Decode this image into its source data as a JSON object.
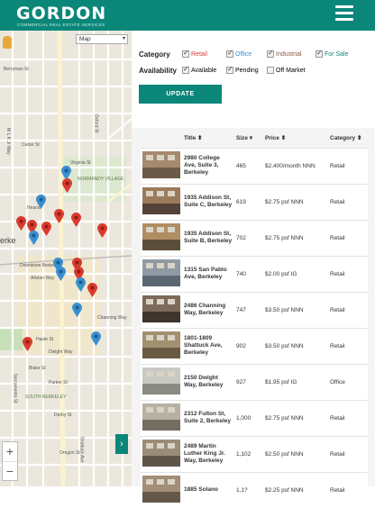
{
  "brand": {
    "logo": "GORDON",
    "tagline": "COMMERCIAL REAL ESTATE SERVICES"
  },
  "colors": {
    "accent": "#0b8779",
    "pin_red": "#d93a2e",
    "pin_blue": "#3a8fd0"
  },
  "map": {
    "type_select": "Map",
    "labels": {
      "berryman": "Berryman St",
      "virginia": "Virginia St",
      "cedar": "Cedar St",
      "normandy": "NORMANDY VILLAGE",
      "hearst": "Hearst",
      "downtown": "Downtown Berkeley",
      "allston": "Allston Way",
      "channing": "Channing Way",
      "haste": "Haste St",
      "dwight": "Dwight Way",
      "parker": "Parker St",
      "derby": "Derby St",
      "south": "SOUTH BERKELEY",
      "blake": "Blake St",
      "oxford": "Oxford St",
      "shattuck": "Shattuck Ave",
      "sacramento": "Sacramento St",
      "mlk": "M L K Jr Way",
      "oregon": "Oregon St",
      "berke": "erke"
    },
    "zoom_in": "+",
    "zoom_out": "−",
    "expand": "›"
  },
  "filters": {
    "category_label": "Category",
    "availability_label": "Availability",
    "category": [
      {
        "label": "Retail",
        "checked": true,
        "color": "#d93a2e"
      },
      {
        "label": "Office",
        "checked": true,
        "color": "#3a8fd0"
      },
      {
        "label": "Industrial",
        "checked": true,
        "color": "#8a5a3b"
      },
      {
        "label": "For Sale",
        "checked": true,
        "color": "#0b8779"
      }
    ],
    "availability": [
      {
        "label": "Available",
        "checked": true
      },
      {
        "label": "Pending",
        "checked": true
      },
      {
        "label": "Off Market",
        "checked": false
      }
    ],
    "update_label": "UPDATE"
  },
  "table": {
    "headers": [
      "Title ⬍",
      "Size ▾",
      "Price ⬍",
      "Category ⬍"
    ],
    "rows": [
      {
        "title": "2980 College Ave, Suite 3, Berkeley",
        "size": "465",
        "price": "$2,400/month NNN",
        "category": "Retail"
      },
      {
        "title": "1935 Addison St, Suite C, Berkeley",
        "size": "619",
        "price": "$2.75 psf NNN",
        "category": "Retail"
      },
      {
        "title": "1935 Addison St, Suite B, Berkeley",
        "size": "702",
        "price": "$2.75 psf NNN",
        "category": "Retail"
      },
      {
        "title": "1315 San Pablo Ave, Berkeley",
        "size": "740",
        "price": "$2.00 psf IG",
        "category": "Retail"
      },
      {
        "title": "2486 Channing Way, Berkeley",
        "size": "747",
        "price": "$3.50 psf NNN",
        "category": "Retail"
      },
      {
        "title": "1801-1809 Shattuck Ave, Berkeley",
        "size": "902",
        "price": "$3.50 psf NNN",
        "category": "Retail"
      },
      {
        "title": "2150 Dwight Way, Berkeley",
        "size": "927",
        "price": "$1.95 psf IG",
        "category": "Office"
      },
      {
        "title": "2312 Fulton St, Suite 2, Berkeley",
        "size": "1,000",
        "price": "$2.75 psf NNN",
        "category": "Retail"
      },
      {
        "title": "2489 Martin Luther King Jr. Way, Berkeley",
        "size": "1,102",
        "price": "$2.50 psf NNN",
        "category": "Retail"
      },
      {
        "title": "1885 Solano",
        "size": "1,1?",
        "price": "$2.25 psf NNN",
        "category": "Retail"
      }
    ]
  }
}
